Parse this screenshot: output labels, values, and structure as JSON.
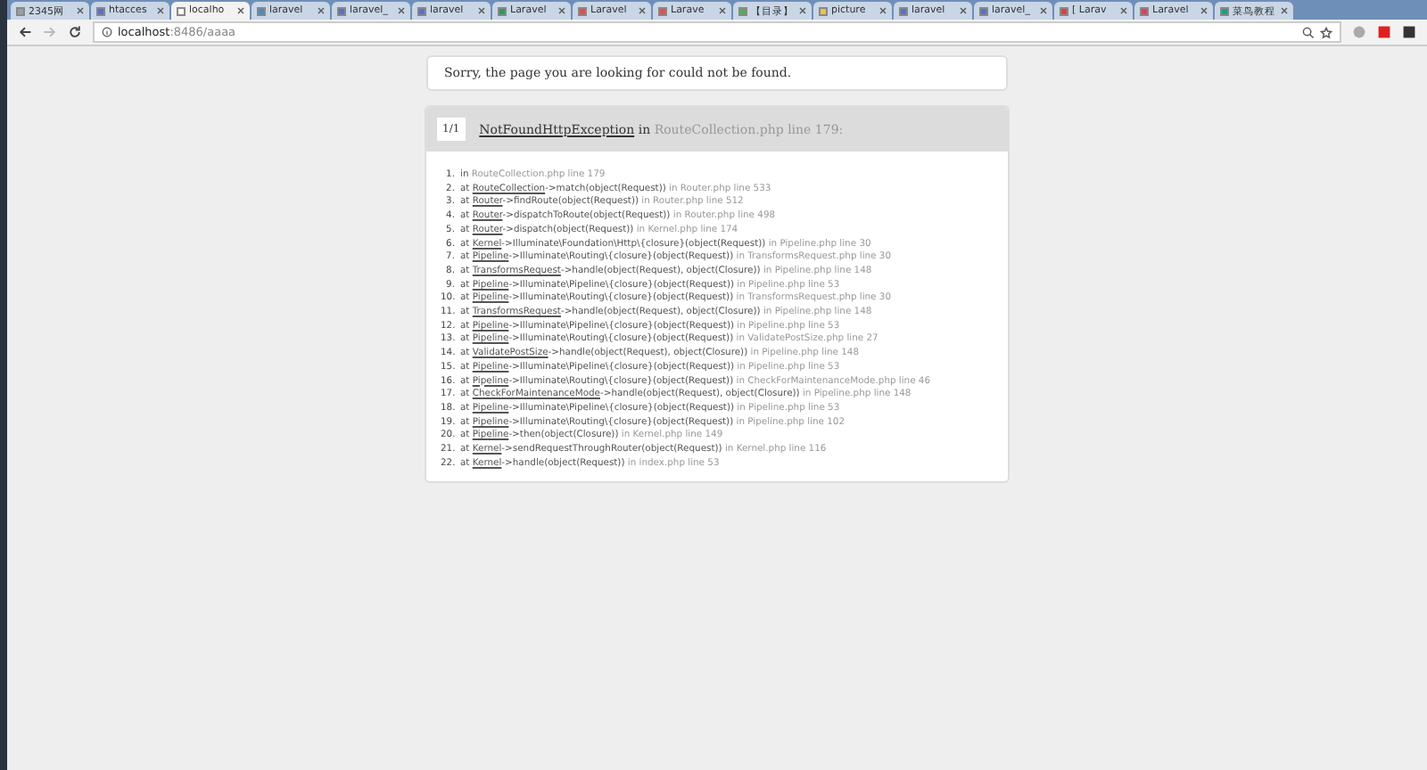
{
  "tabs": [
    {
      "label": "2345网",
      "selected": false,
      "color": "#9aa0a8"
    },
    {
      "label": "htacces",
      "selected": false,
      "color": "#5a6fd8"
    },
    {
      "label": "localho",
      "selected": true,
      "color": "#ffffff"
    },
    {
      "label": "laravel",
      "selected": false,
      "color": "#3a8fd8"
    },
    {
      "label": "laravel_",
      "selected": false,
      "color": "#5a6fd8"
    },
    {
      "label": "laravel",
      "selected": false,
      "color": "#5a6fd8"
    },
    {
      "label": "Laravel",
      "selected": false,
      "color": "#2e9a5a"
    },
    {
      "label": "Laravel",
      "selected": false,
      "color": "#e05050"
    },
    {
      "label": "Larave",
      "selected": false,
      "color": "#e05050"
    },
    {
      "label": "【目录】",
      "selected": false,
      "color": "#4caf50"
    },
    {
      "label": "picture",
      "selected": false,
      "color": "#f0c040"
    },
    {
      "label": "laravel",
      "selected": false,
      "color": "#5a6fd8"
    },
    {
      "label": "laravel_",
      "selected": false,
      "color": "#5a6fd8"
    },
    {
      "label": "[ Larav",
      "selected": false,
      "color": "#e04040"
    },
    {
      "label": "Laravel",
      "selected": false,
      "color": "#e04060"
    },
    {
      "label": "菜鸟教程",
      "selected": false,
      "color": "#20a080"
    }
  ],
  "address": {
    "host": "localhost",
    "path": ":8486/aaaa"
  },
  "message": "Sorry, the page you are looking for could not be found.",
  "exception": {
    "count": "1/1",
    "name": "NotFoundHttpException",
    "joiner": "in",
    "location": "RouteCollection.php line 179:"
  },
  "trace": [
    {
      "number": "1.",
      "prefix": "in",
      "location": "RouteCollection.php line 179"
    },
    {
      "number": "2.",
      "prefix": "at",
      "cls": "RouteCollection",
      "call": "->match(object(Request))",
      "location": "in Router.php line 533"
    },
    {
      "number": "3.",
      "prefix": "at",
      "cls": "Router",
      "call": "->findRoute(object(Request))",
      "location": "in Router.php line 512"
    },
    {
      "number": "4.",
      "prefix": "at",
      "cls": "Router",
      "call": "->dispatchToRoute(object(Request))",
      "location": "in Router.php line 498"
    },
    {
      "number": "5.",
      "prefix": "at",
      "cls": "Router",
      "call": "->dispatch(object(Request))",
      "location": "in Kernel.php line 174"
    },
    {
      "number": "6.",
      "prefix": "at",
      "cls": "Kernel",
      "call": "->Illuminate\\Foundation\\Http\\{closure}(object(Request))",
      "location": "in Pipeline.php line 30"
    },
    {
      "number": "7.",
      "prefix": "at",
      "cls": "Pipeline",
      "call": "->Illuminate\\Routing\\{closure}(object(Request))",
      "location": "in TransformsRequest.php line 30"
    },
    {
      "number": "8.",
      "prefix": "at",
      "cls": "TransformsRequest",
      "call": "->handle(object(Request), object(Closure))",
      "location": "in Pipeline.php line 148"
    },
    {
      "number": "9.",
      "prefix": "at",
      "cls": "Pipeline",
      "call": "->Illuminate\\Pipeline\\{closure}(object(Request))",
      "location": "in Pipeline.php line 53"
    },
    {
      "number": "10.",
      "prefix": "at",
      "cls": "Pipeline",
      "call": "->Illuminate\\Routing\\{closure}(object(Request))",
      "location": "in TransformsRequest.php line 30"
    },
    {
      "number": "11.",
      "prefix": "at",
      "cls": "TransformsRequest",
      "call": "->handle(object(Request), object(Closure))",
      "location": "in Pipeline.php line 148"
    },
    {
      "number": "12.",
      "prefix": "at",
      "cls": "Pipeline",
      "call": "->Illuminate\\Pipeline\\{closure}(object(Request))",
      "location": "in Pipeline.php line 53"
    },
    {
      "number": "13.",
      "prefix": "at",
      "cls": "Pipeline",
      "call": "->Illuminate\\Routing\\{closure}(object(Request))",
      "location": "in ValidatePostSize.php line 27"
    },
    {
      "number": "14.",
      "prefix": "at",
      "cls": "ValidatePostSize",
      "call": "->handle(object(Request), object(Closure))",
      "location": "in Pipeline.php line 148"
    },
    {
      "number": "15.",
      "prefix": "at",
      "cls": "Pipeline",
      "call": "->Illuminate\\Pipeline\\{closure}(object(Request))",
      "location": "in Pipeline.php line 53"
    },
    {
      "number": "16.",
      "prefix": "at",
      "cls": "Pipeline",
      "call": "->Illuminate\\Routing\\{closure}(object(Request))",
      "location": "in CheckForMaintenanceMode.php line 46"
    },
    {
      "number": "17.",
      "prefix": "at",
      "cls": "CheckForMaintenanceMode",
      "call": "->handle(object(Request), object(Closure))",
      "location": "in Pipeline.php line 148"
    },
    {
      "number": "18.",
      "prefix": "at",
      "cls": "Pipeline",
      "call": "->Illuminate\\Pipeline\\{closure}(object(Request))",
      "location": "in Pipeline.php line 53"
    },
    {
      "number": "19.",
      "prefix": "at",
      "cls": "Pipeline",
      "call": "->Illuminate\\Routing\\{closure}(object(Request))",
      "location": "in Pipeline.php line 102"
    },
    {
      "number": "20.",
      "prefix": "at",
      "cls": "Pipeline",
      "call": "->then(object(Closure))",
      "location": "in Kernel.php line 149"
    },
    {
      "number": "21.",
      "prefix": "at",
      "cls": "Kernel",
      "call": "->sendRequestThroughRouter(object(Request))",
      "location": "in Kernel.php line 116"
    },
    {
      "number": "22.",
      "prefix": "at",
      "cls": "Kernel",
      "call": "->handle(object(Request))",
      "location": "in index.php line 53"
    }
  ]
}
